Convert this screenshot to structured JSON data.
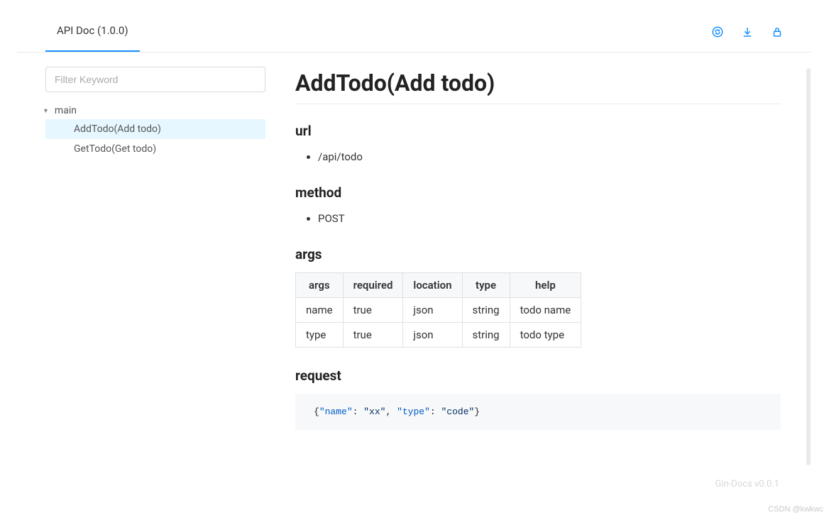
{
  "header": {
    "tab_label": "API Doc (1.0.0)"
  },
  "sidebar": {
    "filter_placeholder": "Filter Keyword",
    "group_label": "main",
    "items": [
      {
        "label": "AddTodo(Add todo)",
        "selected": true
      },
      {
        "label": "GetTodo(Get todo)",
        "selected": false
      }
    ]
  },
  "doc": {
    "title": "AddTodo(Add todo)",
    "sections": {
      "url": {
        "heading": "url",
        "items": [
          "/api/todo"
        ]
      },
      "method": {
        "heading": "method",
        "items": [
          "POST"
        ]
      },
      "args": {
        "heading": "args",
        "headers": [
          "args",
          "required",
          "location",
          "type",
          "help"
        ],
        "rows": [
          [
            "name",
            "true",
            "json",
            "string",
            "todo name"
          ],
          [
            "type",
            "true",
            "json",
            "string",
            "todo type"
          ]
        ]
      },
      "request": {
        "heading": "request",
        "tokens": [
          {
            "t": "punc",
            "v": "{"
          },
          {
            "t": "key",
            "v": "\"name\""
          },
          {
            "t": "punc",
            "v": ": "
          },
          {
            "t": "str",
            "v": "\"xx\""
          },
          {
            "t": "punc",
            "v": ", "
          },
          {
            "t": "key",
            "v": "\"type\""
          },
          {
            "t": "punc",
            "v": ": "
          },
          {
            "t": "str",
            "v": "\"code\""
          },
          {
            "t": "punc",
            "v": "}"
          }
        ]
      }
    }
  },
  "footer": {
    "version": "Gin-Docs v0.0.1",
    "watermark": "CSDN @kwkwc"
  }
}
